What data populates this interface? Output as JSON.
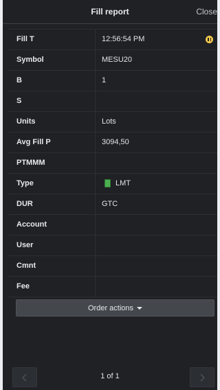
{
  "header": {
    "title": "Fill report",
    "close_label": "Close"
  },
  "rows": [
    {
      "label": "Fill T",
      "value": "12:56:54 PM",
      "icon": "info-icon"
    },
    {
      "label": "Symbol",
      "value": "MESU20"
    },
    {
      "label": "B",
      "value": "1"
    },
    {
      "label": "S",
      "value": ""
    },
    {
      "label": "Units",
      "value": "Lots"
    },
    {
      "label": "Avg Fill P",
      "value": "3094,50"
    },
    {
      "label": "PTMMM",
      "value": ""
    },
    {
      "label": "Type",
      "value": "LMT",
      "swatch_color": "#4caf50"
    },
    {
      "label": "DUR",
      "value": "GTC"
    },
    {
      "label": "Account",
      "value": ""
    },
    {
      "label": "User",
      "value": ""
    },
    {
      "label": "Cmnt",
      "value": ""
    },
    {
      "label": "Fee",
      "value": ""
    }
  ],
  "actions": {
    "order_actions_label": "Order actions"
  },
  "pager": {
    "label": "1 of 1",
    "prev_icon": "chevron-left-icon",
    "next_icon": "chevron-right-icon"
  },
  "colors": {
    "background": "#1f2124",
    "info_icon": "#f2c94c",
    "lmt_swatch": "#4caf50"
  }
}
